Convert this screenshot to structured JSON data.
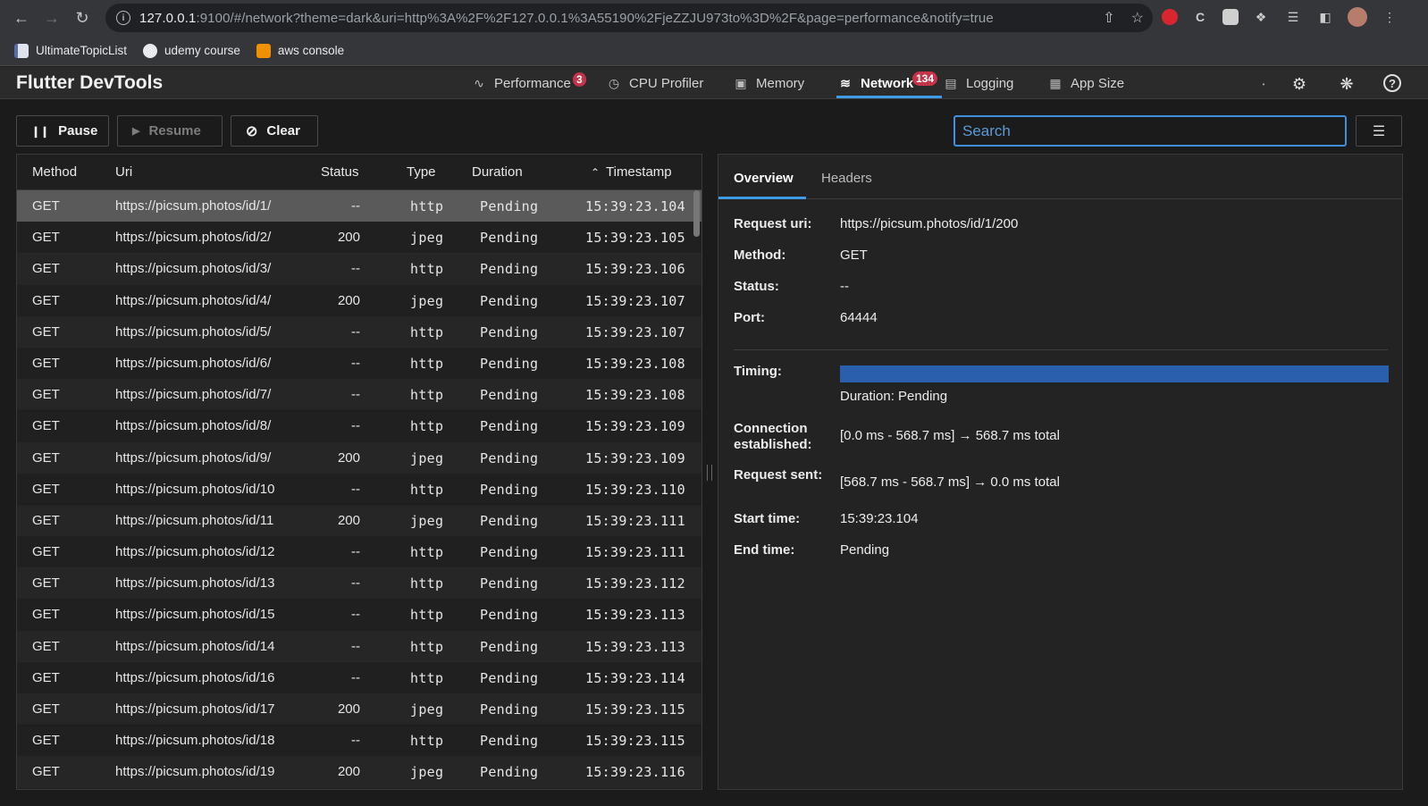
{
  "browser": {
    "url_host": "127.0.0.1",
    "url_rest": ":9100/#/network?theme=dark&uri=http%3A%2F%2F127.0.0.1%3A55190%2FjeZZJU973to%3D%2F&page=performance&notify=true"
  },
  "bookmarks": [
    {
      "label": "UltimateTopicList",
      "icon": "bookmark-icon",
      "color": "#5b6ea8"
    },
    {
      "label": "udemy course",
      "icon": "github-icon",
      "color": "#e8eaed"
    },
    {
      "label": "aws console",
      "icon": "aws-icon",
      "color": "#f29100"
    }
  ],
  "header": {
    "title": "Flutter DevTools",
    "tabs": [
      {
        "label": "Performance",
        "badge": "3",
        "icon": "performance-icon"
      },
      {
        "label": "CPU Profiler",
        "icon": "cpu-profiler-icon"
      },
      {
        "label": "Memory",
        "icon": "memory-icon"
      },
      {
        "label": "Network",
        "badge": "134",
        "icon": "network-icon",
        "active": true
      },
      {
        "label": "Logging",
        "icon": "logging-icon"
      },
      {
        "label": "App Size",
        "icon": "app-size-icon"
      }
    ]
  },
  "controls": {
    "pause": "Pause",
    "resume": "Resume",
    "clear": "Clear",
    "search_placeholder": "Search"
  },
  "table": {
    "headers": {
      "method": "Method",
      "uri": "Uri",
      "status": "Status",
      "type": "Type",
      "duration": "Duration",
      "timestamp": "Timestamp"
    },
    "rows": [
      {
        "method": "GET",
        "uri": "https://picsum.photos/id/1/",
        "status": "--",
        "type": "http",
        "duration": "Pending",
        "timestamp": "15:39:23.104"
      },
      {
        "method": "GET",
        "uri": "https://picsum.photos/id/2/",
        "status": "200",
        "type": "jpeg",
        "duration": "Pending",
        "timestamp": "15:39:23.105"
      },
      {
        "method": "GET",
        "uri": "https://picsum.photos/id/3/",
        "status": "--",
        "type": "http",
        "duration": "Pending",
        "timestamp": "15:39:23.106"
      },
      {
        "method": "GET",
        "uri": "https://picsum.photos/id/4/",
        "status": "200",
        "type": "jpeg",
        "duration": "Pending",
        "timestamp": "15:39:23.107"
      },
      {
        "method": "GET",
        "uri": "https://picsum.photos/id/5/",
        "status": "--",
        "type": "http",
        "duration": "Pending",
        "timestamp": "15:39:23.107"
      },
      {
        "method": "GET",
        "uri": "https://picsum.photos/id/6/",
        "status": "--",
        "type": "http",
        "duration": "Pending",
        "timestamp": "15:39:23.108"
      },
      {
        "method": "GET",
        "uri": "https://picsum.photos/id/7/",
        "status": "--",
        "type": "http",
        "duration": "Pending",
        "timestamp": "15:39:23.108"
      },
      {
        "method": "GET",
        "uri": "https://picsum.photos/id/8/",
        "status": "--",
        "type": "http",
        "duration": "Pending",
        "timestamp": "15:39:23.109"
      },
      {
        "method": "GET",
        "uri": "https://picsum.photos/id/9/",
        "status": "200",
        "type": "jpeg",
        "duration": "Pending",
        "timestamp": "15:39:23.109"
      },
      {
        "method": "GET",
        "uri": "https://picsum.photos/id/10",
        "status": "--",
        "type": "http",
        "duration": "Pending",
        "timestamp": "15:39:23.110"
      },
      {
        "method": "GET",
        "uri": "https://picsum.photos/id/11",
        "status": "200",
        "type": "jpeg",
        "duration": "Pending",
        "timestamp": "15:39:23.111"
      },
      {
        "method": "GET",
        "uri": "https://picsum.photos/id/12",
        "status": "--",
        "type": "http",
        "duration": "Pending",
        "timestamp": "15:39:23.111"
      },
      {
        "method": "GET",
        "uri": "https://picsum.photos/id/13",
        "status": "--",
        "type": "http",
        "duration": "Pending",
        "timestamp": "15:39:23.112"
      },
      {
        "method": "GET",
        "uri": "https://picsum.photos/id/15",
        "status": "--",
        "type": "http",
        "duration": "Pending",
        "timestamp": "15:39:23.113"
      },
      {
        "method": "GET",
        "uri": "https://picsum.photos/id/14",
        "status": "--",
        "type": "http",
        "duration": "Pending",
        "timestamp": "15:39:23.113"
      },
      {
        "method": "GET",
        "uri": "https://picsum.photos/id/16",
        "status": "--",
        "type": "http",
        "duration": "Pending",
        "timestamp": "15:39:23.114"
      },
      {
        "method": "GET",
        "uri": "https://picsum.photos/id/17",
        "status": "200",
        "type": "jpeg",
        "duration": "Pending",
        "timestamp": "15:39:23.115"
      },
      {
        "method": "GET",
        "uri": "https://picsum.photos/id/18",
        "status": "--",
        "type": "http",
        "duration": "Pending",
        "timestamp": "15:39:23.115"
      },
      {
        "method": "GET",
        "uri": "https://picsum.photos/id/19",
        "status": "200",
        "type": "jpeg",
        "duration": "Pending",
        "timestamp": "15:39:23.116"
      }
    ]
  },
  "details": {
    "tabs": {
      "overview": "Overview",
      "headers": "Headers"
    },
    "request_uri_label": "Request uri:",
    "request_uri": "https://picsum.photos/id/1/200",
    "method_label": "Method:",
    "method": "GET",
    "status_label": "Status:",
    "status": "--",
    "port_label": "Port:",
    "port": "64444",
    "timing_label": "Timing:",
    "duration_text": "Duration: Pending",
    "connection_label_1": "Connection",
    "connection_label_2": "established:",
    "connection_value": "[0.0 ms - 568.7 ms] → 568.7 ms total",
    "request_sent_label": "Request sent:",
    "request_sent_value": "[568.7 ms - 568.7 ms] → 0.0 ms total",
    "start_time_label": "Start time:",
    "start_time": "15:39:23.104",
    "end_time_label": "End time:",
    "end_time": "Pending"
  }
}
